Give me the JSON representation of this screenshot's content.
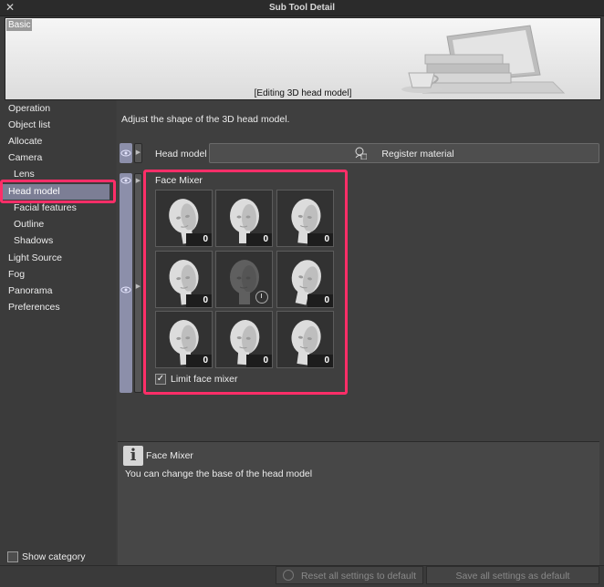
{
  "window": {
    "title": "Sub Tool Detail",
    "close_glyph": "✕"
  },
  "preview": {
    "tag": "Basic",
    "caption": "[Editing 3D head model]"
  },
  "sidebar": {
    "items": [
      {
        "label": "Operation"
      },
      {
        "label": "Object list"
      },
      {
        "label": "Allocate"
      },
      {
        "label": "Camera"
      },
      {
        "label": "Lens"
      },
      {
        "label": "Head model"
      },
      {
        "label": "Facial features"
      },
      {
        "label": "Outline"
      },
      {
        "label": "Shadows"
      },
      {
        "label": "Light Source"
      },
      {
        "label": "Fog"
      },
      {
        "label": "Panorama"
      },
      {
        "label": "Preferences"
      }
    ],
    "selected": "Head model",
    "show_category": {
      "label": "Show category",
      "checked": false
    }
  },
  "main": {
    "description": "Adjust the shape of the 3D head model.",
    "head_model": {
      "label": "Head model",
      "register_label": "Register material"
    },
    "face_mixer": {
      "title": "Face Mixer",
      "values": [
        "0",
        "0",
        "0",
        "0",
        "",
        "0",
        "0",
        "0",
        "0"
      ],
      "limit_label": "Limit face mixer",
      "limit_checked": true,
      "check_glyph": "✓"
    }
  },
  "info": {
    "title": "Face Mixer",
    "text": "You can change the base of the head model",
    "icon_glyph": "i"
  },
  "footer": {
    "reset_label": "Reset all settings to default",
    "save_label": "Save all settings as default"
  },
  "colors": {
    "accent": "#ff2e68",
    "selected": "#7c7e95",
    "background": "#3d3d3d"
  }
}
